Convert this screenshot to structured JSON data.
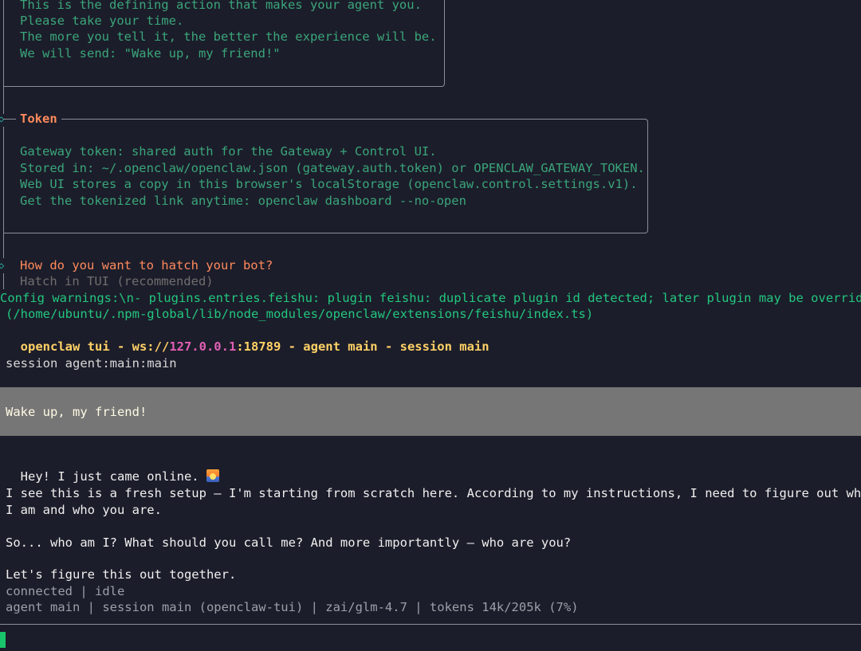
{
  "hatch_box": {
    "lines": [
      "This is the defining action that makes your agent you.",
      "Please take your time.",
      "The more you tell it, the better the experience will be.",
      "We will send: \"Wake up, my friend!\""
    ]
  },
  "token_box": {
    "title": "Token",
    "lines": [
      "Gateway token: shared auth for the Gateway + Control UI.",
      "Stored in: ~/.openclaw/openclaw.json (gateway.auth.token) or OPENCLAW_GATEWAY_TOKEN.",
      "Web UI stores a copy in this browser's localStorage (openclaw.control.settings.v1).",
      "Get the tokenized link anytime: openclaw dashboard --no-open"
    ]
  },
  "hatch_prompt": {
    "question": "How do you want to hatch your bot?",
    "selected": "Hatch in TUI (recommended)"
  },
  "config_warning": {
    "line1": "Config warnings:\\n- plugins.entries.feishu: plugin feishu: duplicate plugin id detected; later plugin may be overridden",
    "line2": "(/home/ubuntu/.npm-global/lib/node_modules/openclaw/extensions/feishu/index.ts)"
  },
  "tui_header": {
    "prefix": "openclaw tui - ws://",
    "host": "127.0.0.1",
    "suffix": ":18789 - agent main - session main"
  },
  "session_line": "session agent:main:main",
  "user_message": "Wake up, my friend!",
  "assistant": {
    "line1": "Hey! I just came online. ",
    "line1_icon": "sunrise-emoji",
    "line2": "I see this is a fresh setup — I'm starting from scratch here. According to my instructions, I need to figure out who",
    "line3": "I am and who you are.",
    "line4": "So... who am I? What should you call me? And more importantly — who are you?",
    "line5": "Let's figure this out together."
  },
  "status": {
    "connection": "connected | idle",
    "footer": "agent main | session main (openclaw-tui) | zai/glm-4.7 | tokens 14k/205k (7%)"
  },
  "colors": {
    "background": "#1c1d2a",
    "accent_orange": "#ff8a5c",
    "muted_green": "#3aa57a",
    "bright_green": "#22c77f",
    "header_yellow": "#ffd166",
    "host_magenta": "#e05fb4",
    "user_bubble": "#767676",
    "cursor": "#19c56a"
  }
}
